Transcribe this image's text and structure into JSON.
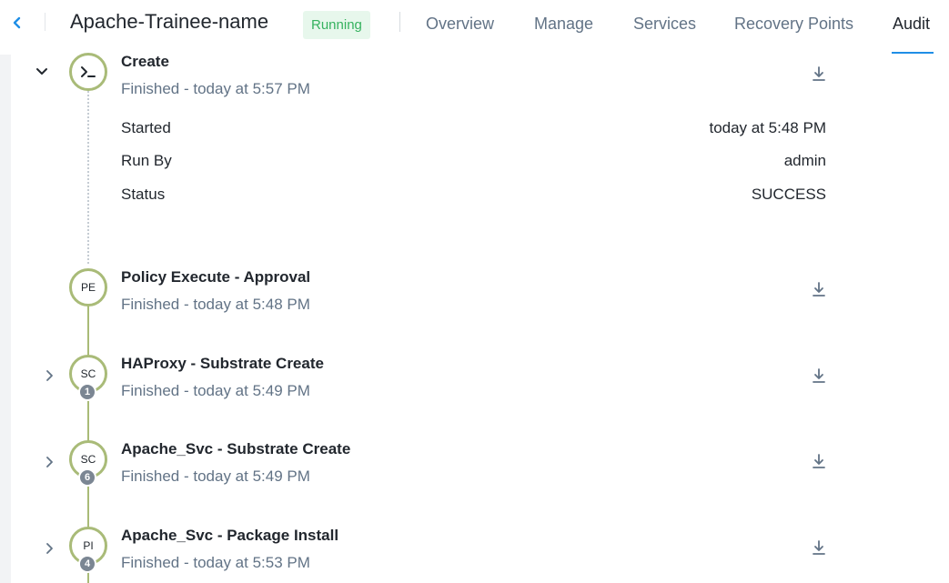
{
  "header": {
    "back_icon": "chevron-left-icon",
    "app_name": "Apache-Trainee-name",
    "status": "Running",
    "tabs": [
      {
        "label": "Overview"
      },
      {
        "label": "Manage"
      },
      {
        "label": "Services"
      },
      {
        "label": "Recovery Points"
      },
      {
        "label": "Audit"
      }
    ],
    "active_tab": "Audit",
    "accent_color": "#1f8ee6",
    "status_color": "#36b25f"
  },
  "audit": {
    "tasks": [
      {
        "title": "Create",
        "subtitle": "Finished - today at 5:57 PM",
        "icon": "terminal-icon",
        "expanded": true
      },
      {
        "title": "Policy Execute - Approval",
        "subtitle": "Finished - today at 5:48 PM",
        "initials": "PE"
      },
      {
        "title": "HAProxy - Substrate Create",
        "subtitle": "Finished - today at 5:49 PM",
        "initials": "SC",
        "count": "1"
      },
      {
        "title": "Apache_Svc - Substrate Create",
        "subtitle": "Finished - today at 5:49 PM",
        "initials": "SC",
        "count": "6"
      },
      {
        "title": "Apache_Svc - Package Install",
        "subtitle": "Finished - today at 5:53 PM",
        "initials": "PI",
        "count": "4"
      }
    ],
    "details": [
      {
        "label": "Started",
        "value": "today at 5:48 PM"
      },
      {
        "label": "Run By",
        "value": "admin"
      },
      {
        "label": "Status",
        "value": "SUCCESS"
      }
    ],
    "node_color": "#a9bb78",
    "download_icon": "download-icon"
  }
}
